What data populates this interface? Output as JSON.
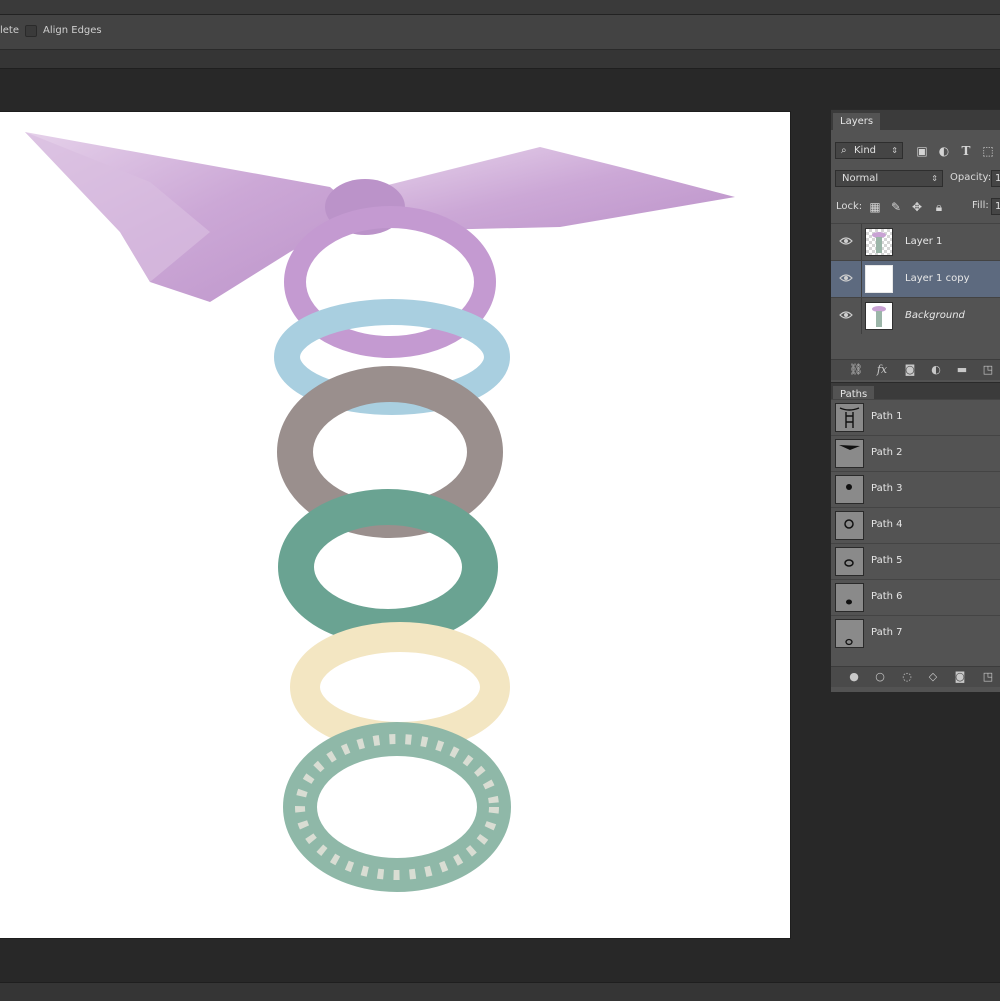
{
  "options_bar": {
    "left_text": "lete",
    "align_edges_label": "Align Edges",
    "align_edges_checked": false
  },
  "layers_panel": {
    "tab_label": "Layers",
    "filter": {
      "value": "Kind",
      "search_icon": "search-icon"
    },
    "filter_icons": [
      "image-filter-icon",
      "adjustment-filter-icon",
      "type-filter-icon",
      "shape-filter-icon"
    ],
    "blend_mode": "Normal",
    "opacity_label": "Opacity:",
    "opacity_value": "1",
    "lock_label": "Lock:",
    "lock_icons": [
      "lock-transparent-icon",
      "lock-brush-icon",
      "lock-move-icon",
      "lock-all-icon"
    ],
    "fill_label": "Fill:",
    "fill_value": "1",
    "layers": [
      {
        "name": "Layer 1",
        "visible": true,
        "selected": false,
        "italic": false
      },
      {
        "name": "Layer 1 copy",
        "visible": true,
        "selected": true,
        "italic": false
      },
      {
        "name": "Background",
        "visible": true,
        "selected": false,
        "italic": true
      }
    ],
    "footer_icons": [
      "link-icon",
      "fx-icon",
      "mask-icon",
      "adjustment-icon",
      "folder-icon",
      "new-layer-icon"
    ],
    "fx_label": "fx"
  },
  "paths_panel": {
    "tab_label": "Paths",
    "paths": [
      {
        "name": "Path 1"
      },
      {
        "name": "Path 2"
      },
      {
        "name": "Path 3"
      },
      {
        "name": "Path 4"
      },
      {
        "name": "Path 5"
      },
      {
        "name": "Path 6"
      },
      {
        "name": "Path 7"
      }
    ],
    "footer_icons": [
      "fill-path-icon",
      "stroke-path-icon",
      "load-selection-icon",
      "make-work-path-icon",
      "add-mask-icon",
      "new-path-icon"
    ]
  },
  "colors": {
    "selected_row": "#5d6a7f",
    "panel_bg": "#535353",
    "workspace_bg": "#282828",
    "ribbon_lilac": "#c9a3d4",
    "scrunchie_blue": "#a9cfe0",
    "scrunchie_gray": "#9a8f8d",
    "scrunchie_green": "#6aa392",
    "scrunchie_cream": "#f3e6c2",
    "scrunchie_plaid": "#8fb8a8"
  }
}
